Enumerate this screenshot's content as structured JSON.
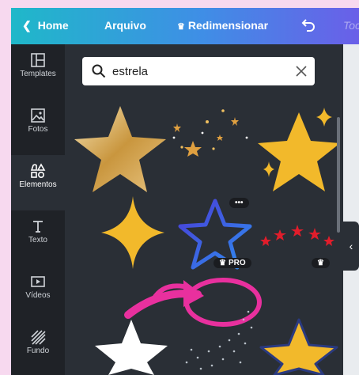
{
  "topbar": {
    "home_label": "Home",
    "file_label": "Arquivo",
    "resize_label": "Redimensionar",
    "next_label": "Toc"
  },
  "sidebar": {
    "items": [
      {
        "label": "Templates",
        "icon": "templates-icon"
      },
      {
        "label": "Fotos",
        "icon": "photos-icon"
      },
      {
        "label": "Elementos",
        "icon": "elements-icon",
        "active": true
      },
      {
        "label": "Texto",
        "icon": "text-icon"
      },
      {
        "label": "Vídeos",
        "icon": "video-icon"
      },
      {
        "label": "Fundo",
        "icon": "background-icon"
      }
    ]
  },
  "search": {
    "value": "estrela"
  },
  "badges": {
    "pro_label": "PRO",
    "more_label": "•••"
  },
  "colors": {
    "gold": "#f2b92b",
    "pink_annotation": "#e8309e",
    "topbar_start": "#1fb8c9",
    "topbar_end": "#6a5fe8"
  }
}
